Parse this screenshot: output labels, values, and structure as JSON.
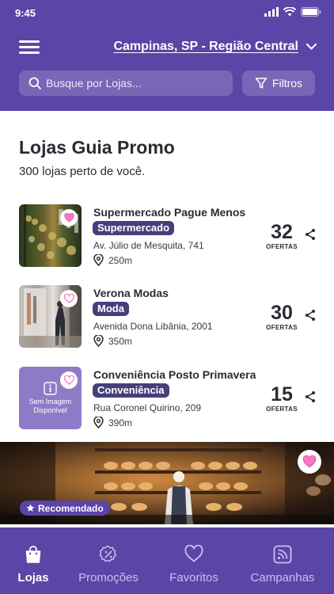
{
  "status_bar": {
    "time": "9:45"
  },
  "header": {
    "location": "Campinas, SP - Região Central",
    "search_placeholder": "Busque por Lojas...",
    "filter_label": "Filtros"
  },
  "page": {
    "title": "Lojas Guia Promo",
    "subtitle": "300 lojas perto de você."
  },
  "stores": [
    {
      "name": "Supermercado Pague Menos",
      "category": "Supermercado",
      "address": "Av. Júlio de Mesquita, 741",
      "distance": "250m",
      "offers": "32",
      "offers_label": "OFERTAS"
    },
    {
      "name": "Verona Modas",
      "category": "Moda",
      "address": "Avenida Dona Libânia, 2001",
      "distance": "350m",
      "offers": "30",
      "offers_label": "OFERTAS"
    },
    {
      "name": "Conveniência Posto Primavera",
      "category": "Conveniência",
      "address": "Rua Coronel Quirino, 209",
      "distance": "390m",
      "offers": "15",
      "offers_label": "OFERTAS",
      "no_image_text": "Sem Imagem Disponível"
    }
  ],
  "banner": {
    "badge": "Recomendado"
  },
  "tabs": [
    {
      "label": "Lojas",
      "icon": "bag-icon",
      "active": true
    },
    {
      "label": "Promoções",
      "icon": "discount-badge-icon",
      "active": false
    },
    {
      "label": "Favoritos",
      "icon": "heart-icon",
      "active": false
    },
    {
      "label": "Campanhas",
      "icon": "campaign-rss-icon",
      "active": false
    }
  ],
  "colors": {
    "primary": "#5b45a6",
    "category_chip": "#46407a",
    "favorite_pink": "#f27bc3"
  }
}
